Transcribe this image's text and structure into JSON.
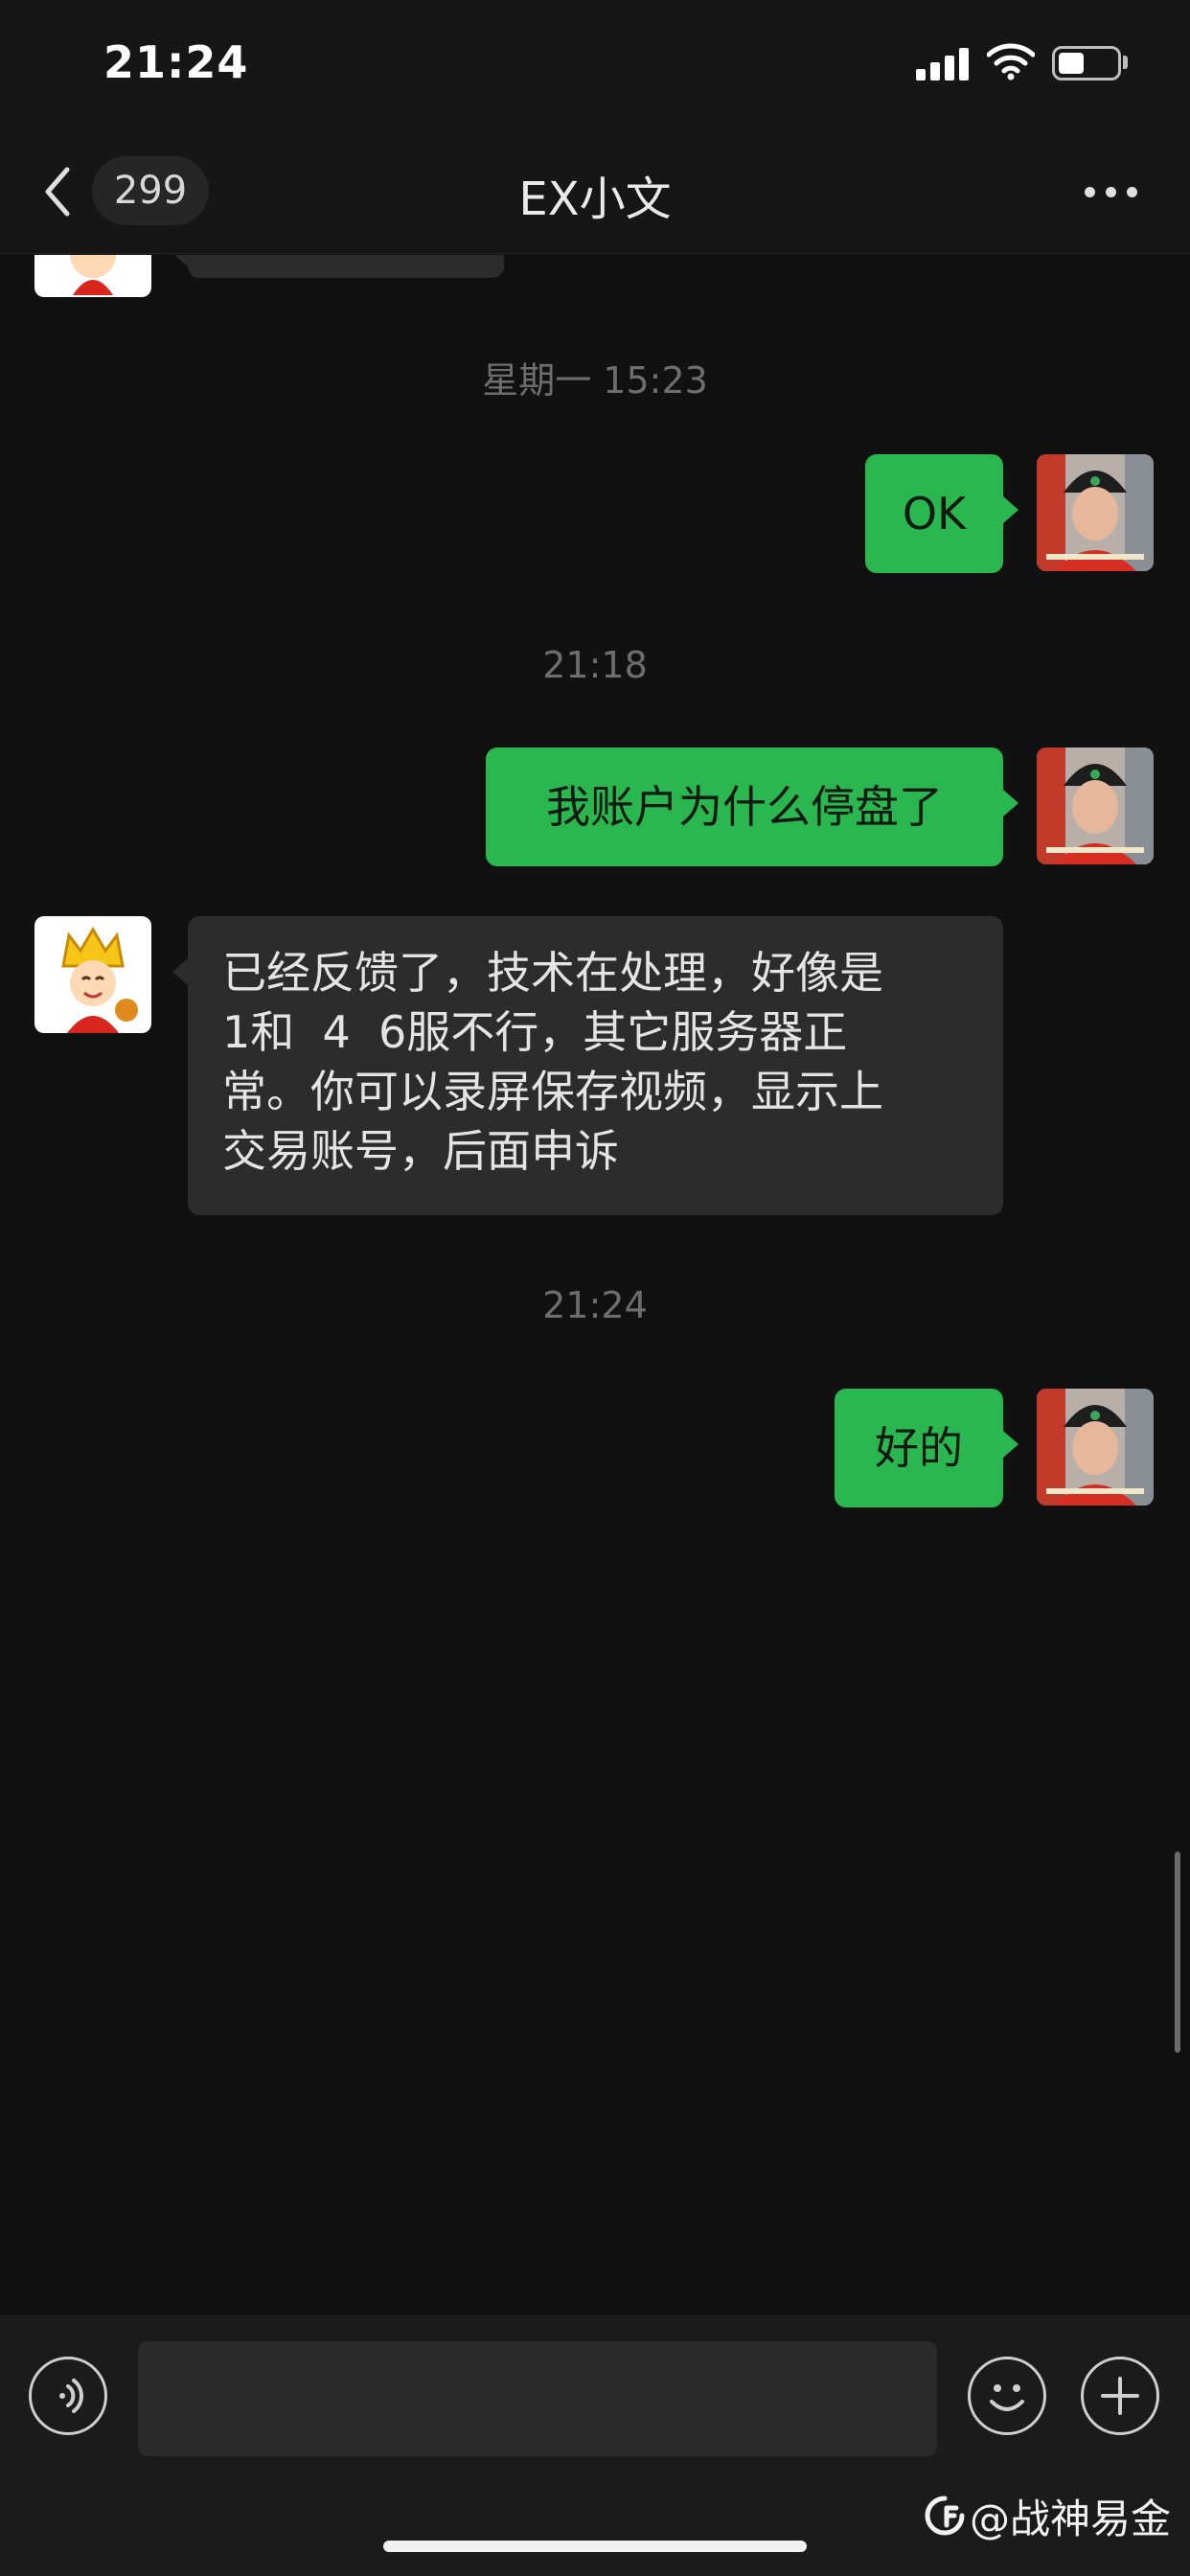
{
  "status_bar": {
    "time": "21:24",
    "battery_level": 0.45
  },
  "nav": {
    "back_label": "back",
    "unread_count": "299",
    "title": "EX小文",
    "more_label": "more"
  },
  "messages": [
    {
      "type": "timestamp",
      "text": "星期一 15:23"
    },
    {
      "type": "outgoing",
      "text": "OK"
    },
    {
      "type": "timestamp",
      "text": "21:18"
    },
    {
      "type": "outgoing",
      "text": "我账户为什么停盘了"
    },
    {
      "type": "incoming",
      "text": "已经反馈了，技术在处理，好像是\n1和  4  6服不行，其它服务器正\n常。你可以录屏保存视频，显示上\n交易账号，后面申诉"
    },
    {
      "type": "timestamp",
      "text": "21:24"
    },
    {
      "type": "outgoing",
      "text": "好的"
    }
  ],
  "input_bar": {
    "placeholder": ""
  },
  "watermark": {
    "text": "@战神易金"
  },
  "colors": {
    "outgoing_bubble": "#2ab74f",
    "incoming_bubble": "#2c2c2c",
    "background": "#111111"
  },
  "icons": [
    "chevron-left-icon",
    "more-dots-icon",
    "voice-icon",
    "emoji-icon",
    "plus-icon"
  ]
}
